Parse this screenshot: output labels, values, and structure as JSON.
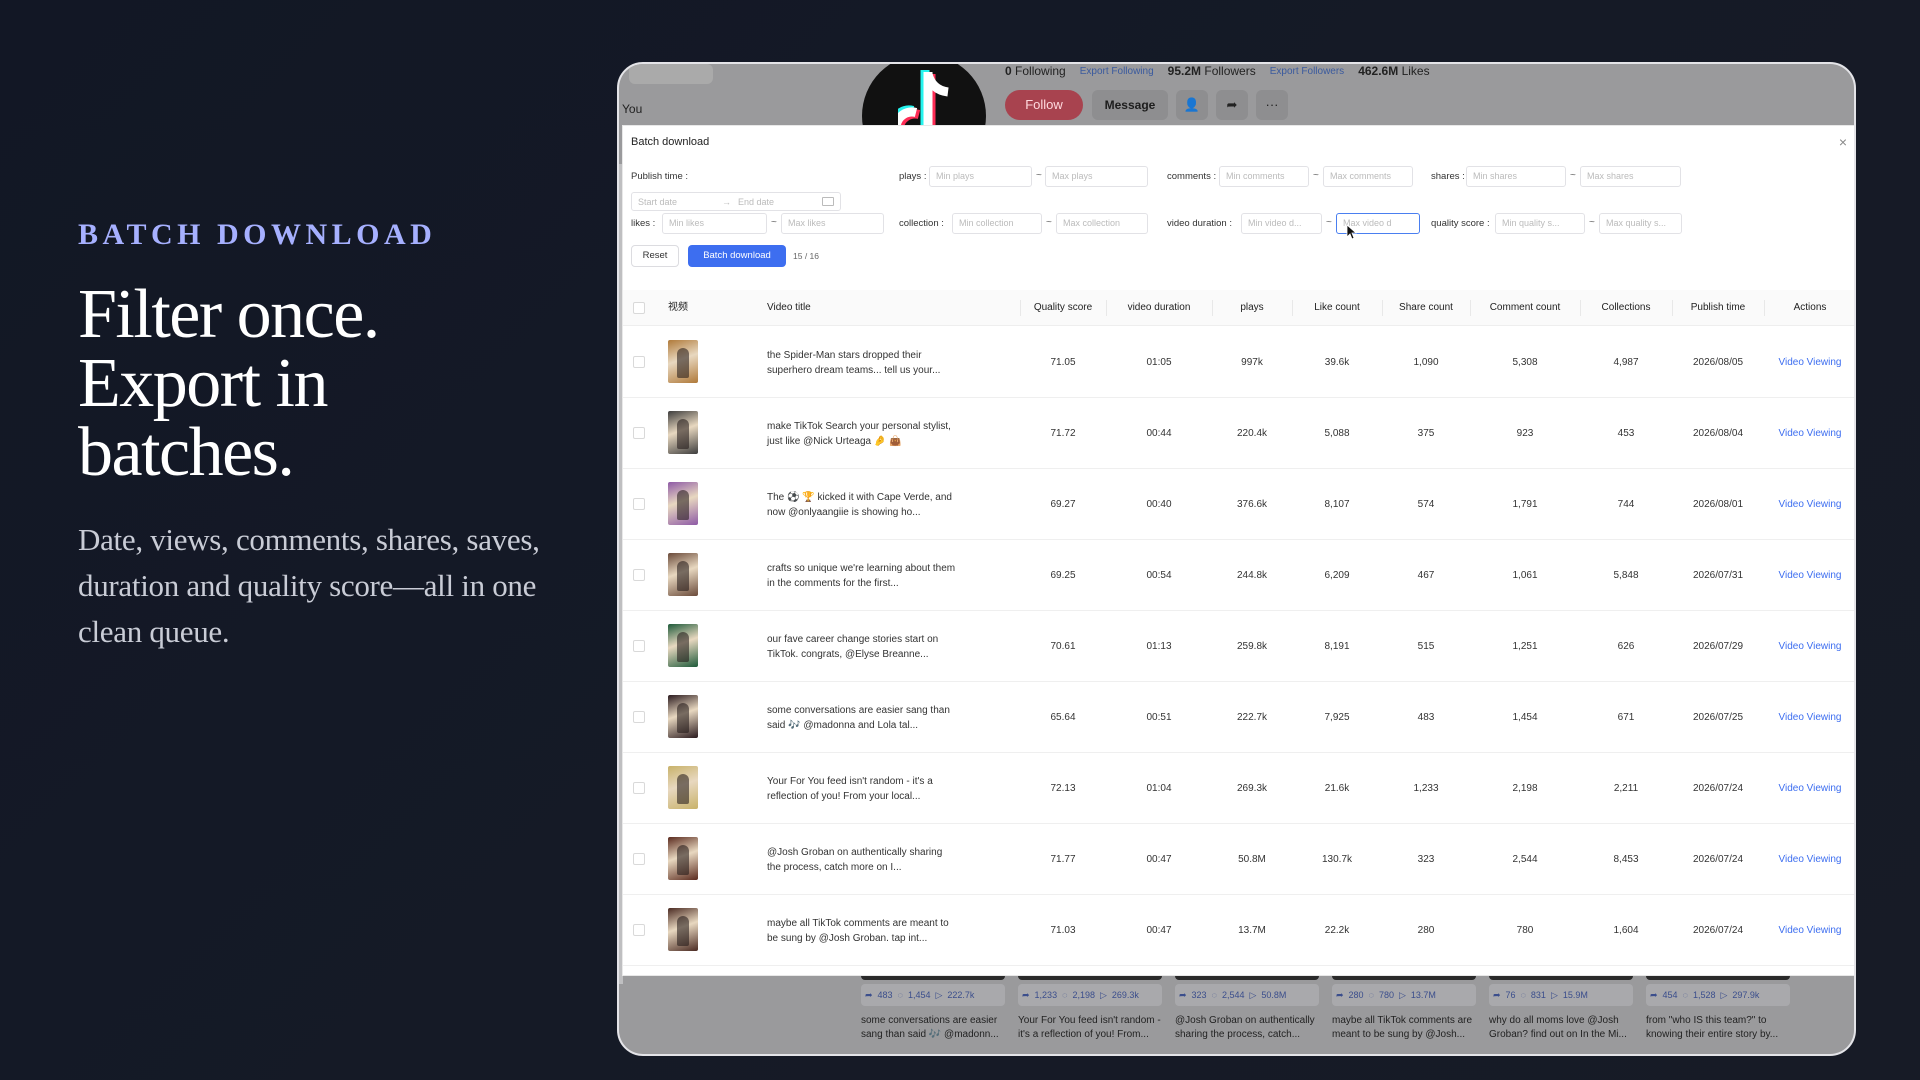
{
  "hero": {
    "eyebrow": "BATCH DOWNLOAD",
    "headline": [
      "Filter once.",
      "Export in",
      "batches."
    ],
    "subtext": "Date, views, comments, shares, saves, duration and quality score—all in one clean queue."
  },
  "profile": {
    "you_label": "You",
    "following_count": "0",
    "following_label": "Following",
    "export_following": "Export Following",
    "followers_count": "95.2M",
    "followers_label": "Followers",
    "export_followers": "Export Followers",
    "likes_count": "462.6M",
    "likes_label": "Likes",
    "follow_label": "Follow",
    "message_label": "Message"
  },
  "background_cards": [
    {
      "shares": "483",
      "comments": "1,454",
      "plays": "222.7k",
      "caption": "some conversations are easier sang than said 🎶 @madonn..."
    },
    {
      "shares": "1,233",
      "comments": "2,198",
      "plays": "269.3k",
      "caption": "Your For You feed isn't random - it's a reflection of you! From..."
    },
    {
      "shares": "323",
      "comments": "2,544",
      "plays": "50.8M",
      "caption": "@Josh Groban on authentically sharing the process, catch..."
    },
    {
      "shares": "280",
      "comments": "780",
      "plays": "13.7M",
      "caption": "maybe all TikTok comments are meant to be sung by @Josh..."
    },
    {
      "shares": "76",
      "comments": "831",
      "plays": "15.9M",
      "caption": "why do all moms love @Josh Groban? find out on In the Mi..."
    },
    {
      "shares": "454",
      "comments": "1,528",
      "plays": "297.9k",
      "caption": "from \"who IS this team?\" to knowing their entire story by..."
    }
  ],
  "modal": {
    "title": "Batch download",
    "filters": {
      "publish_time_label": "Publish time :",
      "start_date_placeholder": "Start date",
      "end_date_placeholder": "End date",
      "plays_label": "plays :",
      "min_plays": "Min plays",
      "max_plays": "Max plays",
      "comments_label": "comments :",
      "min_comments": "Min comments",
      "max_comments": "Max comments",
      "shares_label": "shares :",
      "min_shares": "Min shares",
      "max_shares": "Max shares",
      "likes_label": "likes :",
      "min_likes": "Min likes",
      "max_likes": "Max likes",
      "collection_label": "collection :",
      "min_collection": "Min collection",
      "max_collection": "Max collection",
      "video_duration_label": "video duration :",
      "min_video_duration": "Min video d...",
      "max_video_duration": "Max video d",
      "quality_score_label": "quality score :",
      "min_quality_score": "Min quality s...",
      "max_quality_score": "Max quality s..."
    },
    "reset_label": "Reset",
    "batch_download_label": "Batch download",
    "selection_count": "15 / 16",
    "columns": [
      "视频",
      "Video title",
      "Quality score",
      "video duration",
      "plays",
      "Like count",
      "Share count",
      "Comment count",
      "Collections",
      "Publish time",
      "Actions"
    ],
    "rows": [
      {
        "title": "the Spider-Man stars dropped their superhero dream teams... tell us your...",
        "quality": "71.05",
        "duration": "01:05",
        "plays": "997k",
        "likes": "39.6k",
        "shares": "1,090",
        "comments": "5,308",
        "collections": "4,987",
        "date": "2026/08/05",
        "action": "Video Viewing",
        "thumb_color": "#b07a3a"
      },
      {
        "title": "make TikTok Search your personal stylist, just like @Nick Urteaga 🤌 👜",
        "quality": "71.72",
        "duration": "00:44",
        "plays": "220.4k",
        "likes": "5,088",
        "shares": "375",
        "comments": "923",
        "collections": "453",
        "date": "2026/08/04",
        "action": "Video Viewing",
        "thumb_color": "#3d3d3d"
      },
      {
        "title": "The ⚽ 🏆 kicked it with Cape Verde, and now @onlyaangiie is showing ho...",
        "quality": "69.27",
        "duration": "00:40",
        "plays": "376.6k",
        "likes": "8,107",
        "shares": "574",
        "comments": "1,791",
        "collections": "744",
        "date": "2026/08/01",
        "action": "Video Viewing",
        "thumb_color": "#8e5aa6"
      },
      {
        "title": "crafts so unique we're learning about them in the comments for the first...",
        "quality": "69.25",
        "duration": "00:54",
        "plays": "244.8k",
        "likes": "6,209",
        "shares": "467",
        "comments": "1,061",
        "collections": "5,848",
        "date": "2026/07/31",
        "action": "Video Viewing",
        "thumb_color": "#6a4a3a"
      },
      {
        "title": "our fave career change stories start on TikTok. congrats, @Elyse Breanne...",
        "quality": "70.61",
        "duration": "01:13",
        "plays": "259.8k",
        "likes": "8,191",
        "shares": "515",
        "comments": "1,251",
        "collections": "626",
        "date": "2026/07/29",
        "action": "Video Viewing",
        "thumb_color": "#1e5a3a"
      },
      {
        "title": "some conversations are easier sang than said 🎶 @madonna and Lola tal...",
        "quality": "65.64",
        "duration": "00:51",
        "plays": "222.7k",
        "likes": "7,925",
        "shares": "483",
        "comments": "1,454",
        "collections": "671",
        "date": "2026/07/25",
        "action": "Video Viewing",
        "thumb_color": "#2a1a1e"
      },
      {
        "title": "Your For You feed isn't random - it's a reflection of you! From your local...",
        "quality": "72.13",
        "duration": "01:04",
        "plays": "269.3k",
        "likes": "21.6k",
        "shares": "1,233",
        "comments": "2,198",
        "collections": "2,211",
        "date": "2026/07/24",
        "action": "Video Viewing",
        "thumb_color": "#c8b26a"
      },
      {
        "title": "@Josh Groban on authentically sharing the process, catch more on I...",
        "quality": "71.77",
        "duration": "00:47",
        "plays": "50.8M",
        "likes": "130.7k",
        "shares": "323",
        "comments": "2,544",
        "collections": "8,453",
        "date": "2026/07/24",
        "action": "Video Viewing",
        "thumb_color": "#5a2a1e"
      },
      {
        "title": "maybe all TikTok comments are meant to be sung by @Josh Groban. tap int...",
        "quality": "71.03",
        "duration": "00:47",
        "plays": "13.7M",
        "likes": "22.2k",
        "shares": "280",
        "comments": "780",
        "collections": "1,604",
        "date": "2026/07/24",
        "action": "Video Viewing",
        "thumb_color": "#4a2a22"
      }
    ]
  },
  "colors": {
    "accent": "#3d6ef0",
    "eyebrow": "#a6b0ff",
    "follow": "#a8434f"
  }
}
